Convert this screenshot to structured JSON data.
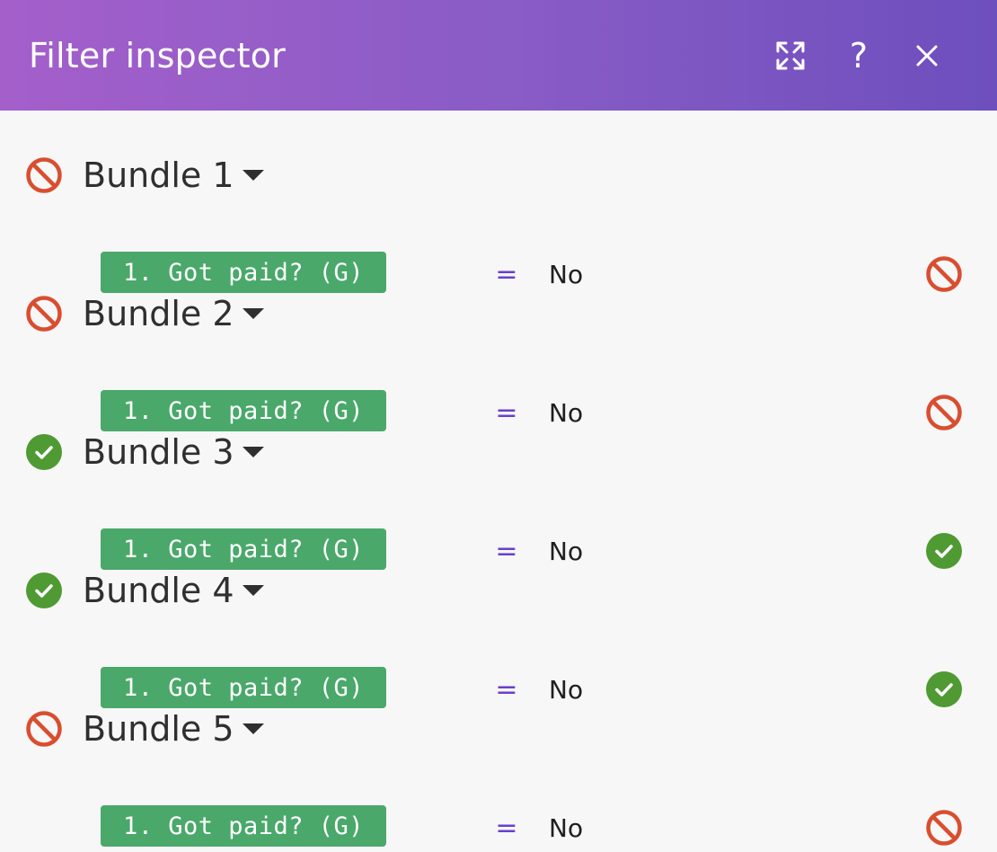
{
  "header": {
    "title": "Filter inspector",
    "help_label": "?"
  },
  "colors": {
    "fail": "#d94e2f",
    "pass": "#4f9a33",
    "pill": "#4aa86a",
    "operator": "#6a3fcf"
  },
  "bundles": [
    {
      "title": "Bundle 1",
      "status": "fail",
      "condition": {
        "field": "1. Got paid? (G)",
        "operator": "=",
        "value": "No",
        "status": "fail"
      }
    },
    {
      "title": "Bundle 2",
      "status": "fail",
      "condition": {
        "field": "1. Got paid? (G)",
        "operator": "=",
        "value": "No",
        "status": "fail"
      }
    },
    {
      "title": "Bundle 3",
      "status": "pass",
      "condition": {
        "field": "1. Got paid? (G)",
        "operator": "=",
        "value": "No",
        "status": "pass"
      }
    },
    {
      "title": "Bundle 4",
      "status": "pass",
      "condition": {
        "field": "1. Got paid? (G)",
        "operator": "=",
        "value": "No",
        "status": "pass"
      }
    },
    {
      "title": "Bundle 5",
      "status": "fail",
      "condition": {
        "field": "1. Got paid? (G)",
        "operator": "=",
        "value": "No",
        "status": "fail"
      }
    }
  ]
}
